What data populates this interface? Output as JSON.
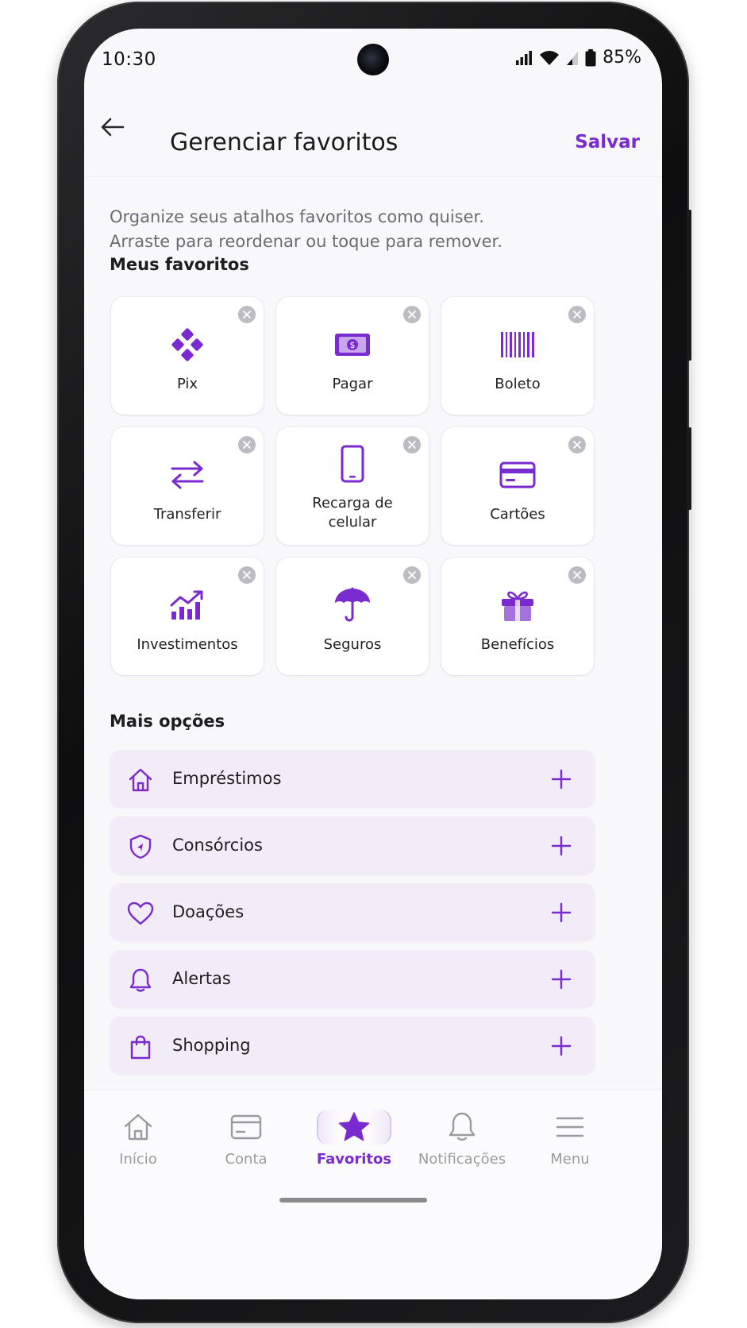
{
  "status_bar": {
    "time": "10:30",
    "battery": "85%"
  },
  "header": {
    "title": "Gerenciar favoritos",
    "save_label": "Salvar"
  },
  "intro": {
    "line1": "Organize seus atalhos favoritos como quiser.",
    "line2": "Arraste para reordenar ou toque para remover."
  },
  "favorites": {
    "title": "Meus favoritos",
    "items": [
      {
        "label": "Pix",
        "icon": "pix-icon"
      },
      {
        "label": "Pagar",
        "icon": "cash-icon"
      },
      {
        "label": "Boleto",
        "icon": "barcode-icon"
      },
      {
        "label": "Transferir",
        "icon": "transfer-arrows-icon"
      },
      {
        "label": "Recarga de celular",
        "icon": "phone-icon"
      },
      {
        "label": "Cartões",
        "icon": "card-icon"
      },
      {
        "label": "Investimentos",
        "icon": "chart-up-icon"
      },
      {
        "label": "Seguros",
        "icon": "umbrella-icon"
      },
      {
        "label": "Benefícios",
        "icon": "gift-icon"
      }
    ]
  },
  "more_options": {
    "title": "Mais opções",
    "items": [
      {
        "label": "Empréstimos",
        "icon": "house-icon"
      },
      {
        "label": "Consórcios",
        "icon": "shield-icon"
      },
      {
        "label": "Doações",
        "icon": "heart-icon"
      },
      {
        "label": "Alertas",
        "icon": "bell-icon"
      },
      {
        "label": "Shopping",
        "icon": "shopping-bag-icon"
      }
    ]
  },
  "bottom_nav": {
    "items": [
      {
        "label": "Início",
        "icon": "home-icon"
      },
      {
        "label": "Conta",
        "icon": "wallet-card-icon"
      },
      {
        "label": "Favoritos",
        "icon": "star-icon"
      },
      {
        "label": "Notificações",
        "icon": "bell-icon"
      },
      {
        "label": "Menu",
        "icon": "hamburger-menu-icon"
      }
    ],
    "active": "Favoritos"
  },
  "colors": {
    "accent": "#7a2bd0",
    "inactive": "#9a9aa1",
    "option_bg": "#f1ecf7"
  }
}
